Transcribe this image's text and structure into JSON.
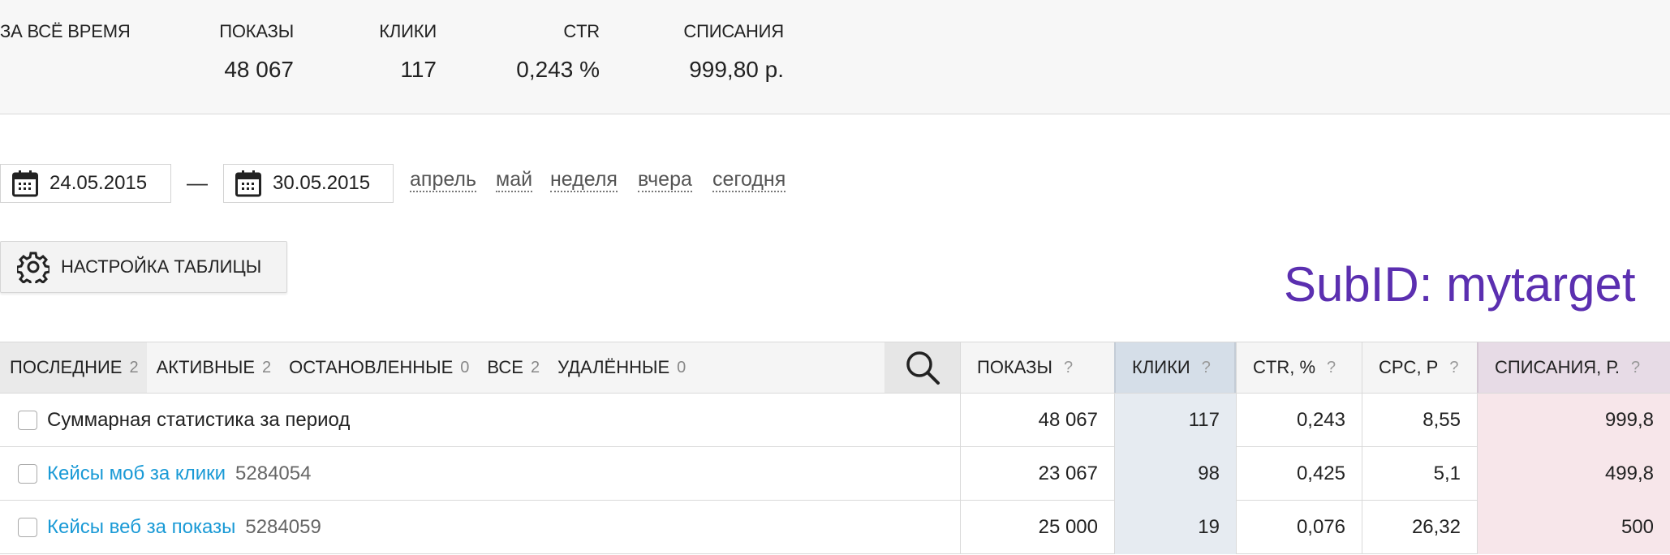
{
  "summary": {
    "period_label": "ЗА ВСЁ ВРЕМЯ",
    "stats": [
      {
        "label": "ПОКАЗЫ",
        "value": "48 067"
      },
      {
        "label": "КЛИКИ",
        "value": "117"
      },
      {
        "label": "CTR",
        "value": "0,243 %"
      },
      {
        "label": "СПИСАНИЯ",
        "value": "999,80 р."
      }
    ]
  },
  "date_range": {
    "from": "24.05.2015",
    "separator": "—",
    "to": "30.05.2015",
    "quick_links": [
      "апрель",
      "май",
      "неделя",
      "вчера",
      "сегодня"
    ]
  },
  "settings_button_label": "НАСТРОЙКА ТАБЛИЦЫ",
  "subid_label": "SubID: mytarget",
  "subid_color": "#5b2fb0",
  "link_color": "#1a9ad6",
  "tabs": [
    {
      "label": "ПОСЛЕДНИЕ",
      "count": "2"
    },
    {
      "label": "АКТИВНЫЕ",
      "count": "2"
    },
    {
      "label": "ОСТАНОВЛЕННЫЕ",
      "count": "0"
    },
    {
      "label": "ВСЕ",
      "count": "2"
    },
    {
      "label": "УДАЛЁННЫЕ",
      "count": "0"
    }
  ],
  "columns": [
    {
      "label": "ПОКАЗЫ",
      "help": "?"
    },
    {
      "label": "КЛИКИ",
      "help": "?"
    },
    {
      "label": "CTR, %",
      "help": "?"
    },
    {
      "label": "CPC, Р",
      "help": "?"
    },
    {
      "label": "СПИСАНИЯ, Р.",
      "help": "?"
    }
  ],
  "rows": [
    {
      "name": "Суммарная статистика за период",
      "id": "",
      "shows": "48 067",
      "clicks": "117",
      "ctr": "0,243",
      "cpc": "8,55",
      "spend": "999,8"
    },
    {
      "name": "Кейсы моб за клики",
      "id": "5284054",
      "shows": "23 067",
      "clicks": "98",
      "ctr": "0,425",
      "cpc": "5,1",
      "spend": "499,8"
    },
    {
      "name": "Кейсы веб за показы",
      "id": "5284059",
      "shows": "25 000",
      "clicks": "19",
      "ctr": "0,076",
      "cpc": "26,32",
      "spend": "500"
    }
  ]
}
